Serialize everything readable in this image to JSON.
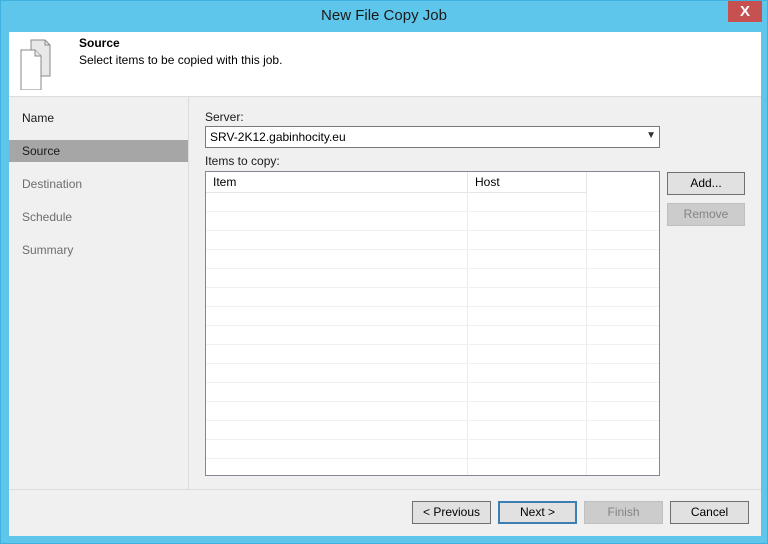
{
  "window": {
    "title": "New File Copy Job",
    "close_glyph": "X"
  },
  "header": {
    "icon": "document-copy-icon",
    "title": "Source",
    "subtitle": "Select items to be copied with this job."
  },
  "steps": [
    {
      "label": "Name",
      "state": "done"
    },
    {
      "label": "Source",
      "state": "active"
    },
    {
      "label": "Destination",
      "state": "pending"
    },
    {
      "label": "Schedule",
      "state": "pending"
    },
    {
      "label": "Summary",
      "state": "pending"
    }
  ],
  "server": {
    "label": "Server:",
    "value": "SRV-2K12.gabinhocity.eu"
  },
  "items": {
    "label": "Items to copy:",
    "columns": [
      "Item",
      "Host"
    ],
    "rows": []
  },
  "side_buttons": {
    "add": "Add...",
    "remove": "Remove"
  },
  "footer": {
    "previous": "< Previous",
    "next": "Next >",
    "finish": "Finish",
    "cancel": "Cancel"
  },
  "colors": {
    "title_bar": "#5ec6ea",
    "close": "#c75050",
    "active_step": "#a6a6a6"
  }
}
